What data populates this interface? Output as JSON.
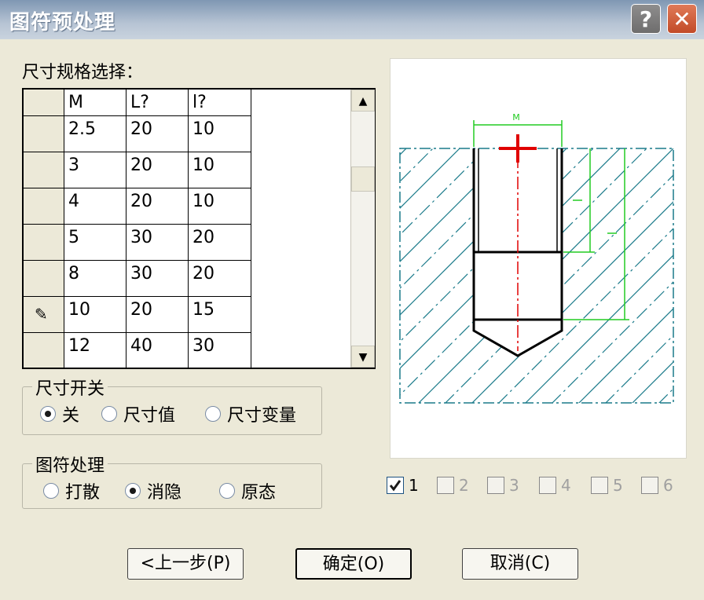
{
  "window": {
    "title": "图符预处理"
  },
  "titlebar_buttons": {
    "help": "?",
    "close": "✕"
  },
  "spec_label": "尺寸规格选择：",
  "table": {
    "columns": [
      "M",
      "L?",
      "l?"
    ],
    "rows": [
      [
        "2.5",
        "20",
        "10"
      ],
      [
        "3",
        "20",
        "10"
      ],
      [
        "4",
        "20",
        "10"
      ],
      [
        "5",
        "30",
        "20"
      ],
      [
        "8",
        "30",
        "20"
      ],
      [
        "10",
        "20",
        "15"
      ],
      [
        "12",
        "40",
        "30"
      ]
    ],
    "editing_row_index": 5
  },
  "dimension_switch": {
    "legend": "尺寸开关",
    "options": [
      "关",
      "尺寸值",
      "尺寸变量"
    ],
    "selected": 0
  },
  "symbol_processing": {
    "legend": "图符处理",
    "options": [
      "打散",
      "消隐",
      "原态"
    ],
    "selected": 1
  },
  "preview": {
    "dim_label": "M",
    "colors": {
      "dimension": "#22cc22",
      "center": "#e00000",
      "hatch": "#1a7a8a",
      "outline": "#000000"
    }
  },
  "views": [
    {
      "label": "1",
      "checked": true,
      "enabled": true
    },
    {
      "label": "2",
      "checked": false,
      "enabled": false
    },
    {
      "label": "3",
      "checked": false,
      "enabled": false
    },
    {
      "label": "4",
      "checked": false,
      "enabled": false
    },
    {
      "label": "5",
      "checked": false,
      "enabled": false
    },
    {
      "label": "6",
      "checked": false,
      "enabled": false
    }
  ],
  "buttons": {
    "prev": "<上一步(P)",
    "ok": "确定(O)",
    "cancel": "取消(C)"
  }
}
